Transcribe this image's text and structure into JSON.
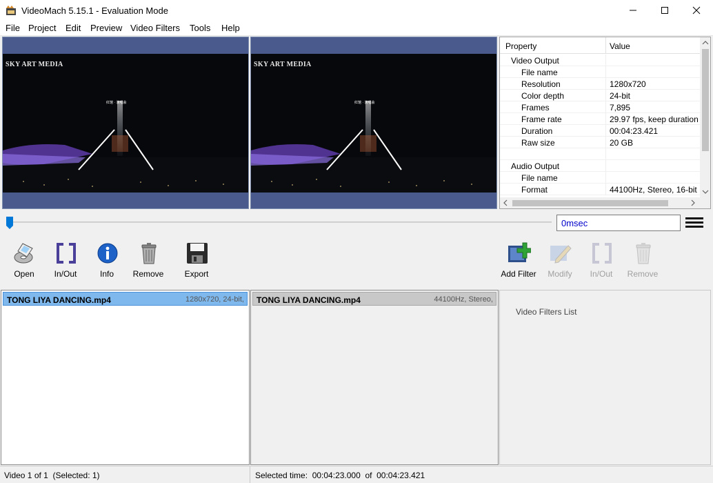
{
  "window": {
    "title": "VideoMach 5.15.1 - Evaluation Mode",
    "minimize_glyph": "—",
    "maximize_glyph": "☐",
    "close_glyph": "✕"
  },
  "menu": [
    "File",
    "Project",
    "Edit",
    "Preview",
    "Video Filters",
    "Tools",
    "Help"
  ],
  "previews": [
    {
      "overlay_text": "SKY ART MEDIA",
      "caption": "红馆 · 演唱会"
    },
    {
      "overlay_text": "SKY ART MEDIA",
      "caption": "红馆 · 演唱会"
    }
  ],
  "properties": {
    "col_property": "Property",
    "col_value": "Value",
    "rows": [
      {
        "key": "Video Output",
        "value": "",
        "level": 0
      },
      {
        "key": "File name",
        "value": "",
        "level": 1
      },
      {
        "key": "Resolution",
        "value": "1280x720",
        "level": 1
      },
      {
        "key": "Color depth",
        "value": "24-bit",
        "level": 1
      },
      {
        "key": "Frames",
        "value": "7,895",
        "level": 1
      },
      {
        "key": "Frame rate",
        "value": "29.97 fps, keep duration",
        "level": 1
      },
      {
        "key": "Duration",
        "value": "00:04:23.421",
        "level": 1
      },
      {
        "key": "Raw size",
        "value": "20 GB",
        "level": 1
      },
      {
        "key": "",
        "value": "",
        "level": 1
      },
      {
        "key": "Audio Output",
        "value": "",
        "level": 0
      },
      {
        "key": "File name",
        "value": "",
        "level": 1
      },
      {
        "key": "Format",
        "value": "44100Hz, Stereo, 16-bit",
        "level": 1
      }
    ]
  },
  "seek": {
    "time": "0msec",
    "position": 0.0
  },
  "toolbar_left": [
    {
      "label": "Open",
      "icon": "open-icon"
    },
    {
      "label": "In/Out",
      "icon": "in-out-icon"
    },
    {
      "label": "Info",
      "icon": "info-icon"
    },
    {
      "label": "Remove",
      "icon": "trash-icon"
    },
    {
      "label": "Export",
      "icon": "save-icon"
    }
  ],
  "toolbar_right": [
    {
      "label": "Add Filter",
      "icon": "add-filter-icon",
      "enabled": true
    },
    {
      "label": "Modify",
      "icon": "modify-icon",
      "enabled": false
    },
    {
      "label": "In/Out",
      "icon": "in-out-icon",
      "enabled": false
    },
    {
      "label": "Remove",
      "icon": "trash-icon",
      "enabled": false
    }
  ],
  "video_list": [
    {
      "name": "TONG LIYA DANCING.mp4",
      "info": "1280x720, 24-bit,"
    }
  ],
  "audio_list": [
    {
      "name": "TONG LIYA DANCING.mp4",
      "info": "44100Hz, Stereo,"
    }
  ],
  "filters": {
    "label": "Video Filters List"
  },
  "status": {
    "video_count": "Video 1 of 1  (Selected: 1)",
    "selected_time": "Selected time:  00:04:23.000  of  00:04:23.421"
  },
  "colors": {
    "selected_row": "#7fb8ec",
    "inactive_row": "#c8c8c8",
    "preview_frame": "#4a5a8c",
    "accent": "#0078d7"
  }
}
